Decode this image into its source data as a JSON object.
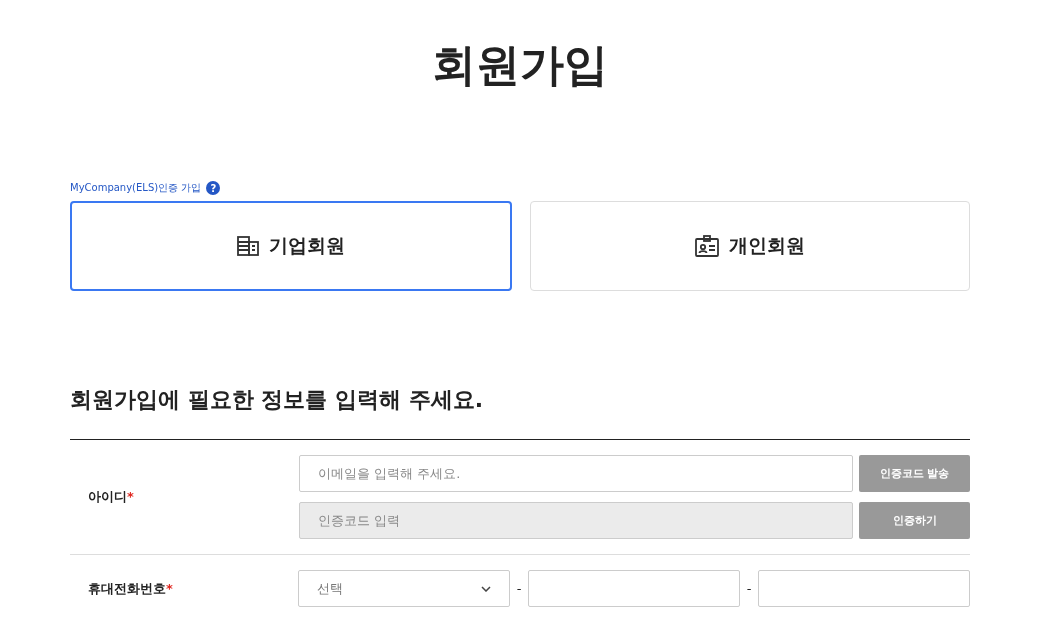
{
  "title": "회원가입",
  "cert_link": {
    "label": "MyCompany(ELS)인증 가입",
    "help_icon": "?"
  },
  "member_types": [
    {
      "label": "기업회원",
      "kind": "company",
      "selected": true
    },
    {
      "label": "개인회원",
      "kind": "personal",
      "selected": false
    }
  ],
  "section_heading": "회원가입에 필요한 정보를 입력해 주세요.",
  "form_rows": [
    {
      "label": "아이디",
      "required": true,
      "required_mark": "*",
      "kind": "id",
      "email": {
        "placeholder": "이메일을 입력해 주세요.",
        "disabled": false
      },
      "send_button": "인증코드 발송",
      "code": {
        "placeholder": "인증코드 입력",
        "disabled": true
      },
      "verify_button": "인증하기"
    },
    {
      "label": "휴대전화번호",
      "required": true,
      "required_mark": "*",
      "kind": "phone",
      "select": {
        "value": "선택"
      },
      "separators": [
        "-",
        "-"
      ]
    }
  ]
}
